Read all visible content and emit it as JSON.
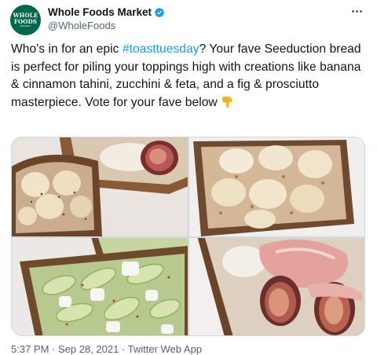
{
  "account": {
    "display_name": "Whole Foods Market",
    "handle": "@WholeFoods",
    "avatar_logo": {
      "line1": "WHOLE",
      "line2": "FOODS",
      "line3": "MARKET"
    },
    "verified_icon": "verified-badge-icon",
    "more_icon": "more-options-icon"
  },
  "tweet": {
    "text_before": "Who's in for an epic ",
    "hashtag": "#toasttuesday",
    "text_after": "? Your fave Seeduction bread is perfect for piling your toppings high with creations like banana & cinnamon tahini, zucchini & feta, and a fig & prosciutto masterpiece. Vote for your fave below ",
    "emoji": "pointing-down-emoji-icon"
  },
  "media": {
    "photos": [
      {
        "label": "toast-photo-banana-fig"
      },
      {
        "label": "toast-photo-banana-cinnamon-tahini"
      },
      {
        "label": "toast-photo-zucchini-feta"
      },
      {
        "label": "toast-photo-fig-prosciutto"
      }
    ]
  },
  "meta": {
    "text": "5:37 PM · Sep 28, 2021 · Twitter Web App"
  },
  "colors": {
    "brand_green": "#00674b",
    "link_blue": "#1d9bf0",
    "text_primary": "#0f1419",
    "text_secondary": "#536471"
  }
}
